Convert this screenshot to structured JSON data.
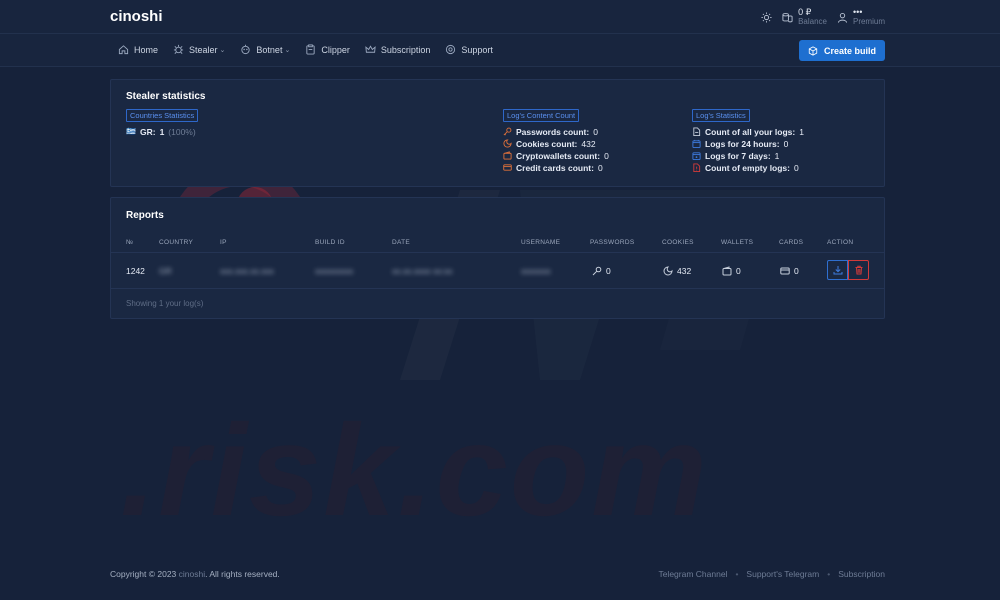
{
  "header": {
    "logo": "cinoshi",
    "balance_value": "0 ₽",
    "balance_label": "Balance",
    "user_value": "•••",
    "user_label": "Premium"
  },
  "nav": {
    "items": [
      {
        "label": "Home",
        "icon": "home-icon"
      },
      {
        "label": "Stealer",
        "icon": "bug-icon",
        "caret": "⌄"
      },
      {
        "label": "Botnet",
        "icon": "bot-icon",
        "caret": "⌄"
      },
      {
        "label": "Clipper",
        "icon": "clipboard-icon"
      },
      {
        "label": "Subscription",
        "icon": "crown-icon"
      },
      {
        "label": "Support",
        "icon": "support-icon"
      }
    ],
    "create_build": "Create build"
  },
  "stats": {
    "title": "Stealer statistics",
    "countries_tag": "Countries Statistics",
    "country": {
      "flag": "🇬🇷",
      "code": "GR:",
      "count": "1",
      "percent": "(100%)"
    },
    "content_tag": "Log's Content Count",
    "content": [
      {
        "label": "Passwords count:",
        "value": "0",
        "icon": "key-icon"
      },
      {
        "label": "Cookies count:",
        "value": "432",
        "icon": "cookie-icon"
      },
      {
        "label": "Cryptowallets count:",
        "value": "0",
        "icon": "wallet-icon"
      },
      {
        "label": "Credit cards count:",
        "value": "0",
        "icon": "card-icon"
      }
    ],
    "logs_tag": "Log's Statistics",
    "logs": [
      {
        "label": "Count of all your logs:",
        "value": "1",
        "icon": "file-icon"
      },
      {
        "label": "Logs for 24 hours:",
        "value": "0",
        "icon": "calendar-icon"
      },
      {
        "label": "Logs for 7 days:",
        "value": "1",
        "icon": "calendar-week-icon"
      },
      {
        "label": "Count of empty logs:",
        "value": "0",
        "icon": "file-empty-icon"
      }
    ]
  },
  "reports": {
    "title": "Reports",
    "columns": [
      "№",
      "COUNTRY",
      "IP",
      "BUILD ID",
      "DATE",
      "USERNAME",
      "PASSWORDS",
      "COOKIES",
      "WALLETS",
      "CARDS",
      "ACTION"
    ],
    "row": {
      "id": "1242",
      "country": "GR",
      "ip": "xxx.xxx.xx.xxx",
      "build_id": "xxxxxxxxx",
      "date": "xx.xx.xxxx xx:xx",
      "username": "xxxxxxx",
      "passwords": "0",
      "cookies": "432",
      "wallets": "0",
      "cards": "0"
    },
    "showing": "Showing 1 your log(s)"
  },
  "footer": {
    "copyright_prefix": "Copyright © 2023",
    "brand": "cinoshi",
    "copyright_suffix": ". All rights reserved.",
    "links": [
      "Telegram Channel",
      "Support's Telegram",
      "Subscription"
    ],
    "separator": "•"
  },
  "watermark": ".risk.com",
  "colors": {
    "background": "#16223a",
    "accent": "#1e6fd0",
    "tag_blue": "#2e67c9",
    "icon_orange": "#e0713a",
    "icon_blue": "#3d7be0",
    "danger": "#d23a3a"
  }
}
